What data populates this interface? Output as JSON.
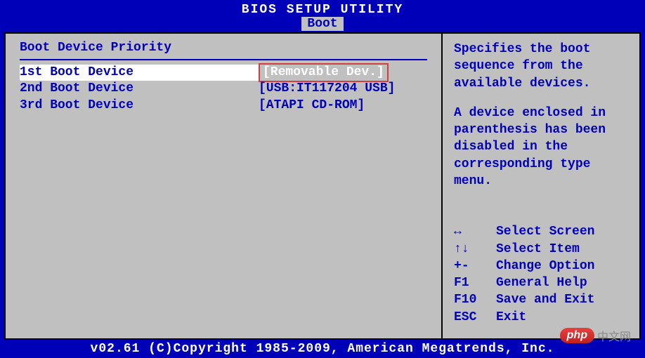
{
  "title": "BIOS SETUP UTILITY",
  "tab": "Boot",
  "section_title": "Boot Device Priority",
  "boot_items": [
    {
      "label": "1st Boot Device",
      "value": "[Removable Dev.]",
      "selected": true
    },
    {
      "label": "2nd Boot Device",
      "value": "[USB:IT117204 USB]",
      "selected": false
    },
    {
      "label": "3rd Boot Device",
      "value": "[ATAPI CD-ROM]",
      "selected": false
    }
  ],
  "help": {
    "p1": "Specifies the boot sequence from the available devices.",
    "p2": "A device enclosed in parenthesis has been disabled in the corresponding type menu."
  },
  "keys": [
    {
      "key": "↔",
      "action": "Select Screen"
    },
    {
      "key": "↑↓",
      "action": "Select Item"
    },
    {
      "key": "+-",
      "action": "Change Option"
    },
    {
      "key": "F1",
      "action": "General Help"
    },
    {
      "key": "F10",
      "action": "Save and Exit"
    },
    {
      "key": "ESC",
      "action": "Exit"
    }
  ],
  "footer": "v02.61 (C)Copyright 1985-2009, American Megatrends, Inc.",
  "watermark": {
    "badge": "php",
    "text": "中文网"
  }
}
